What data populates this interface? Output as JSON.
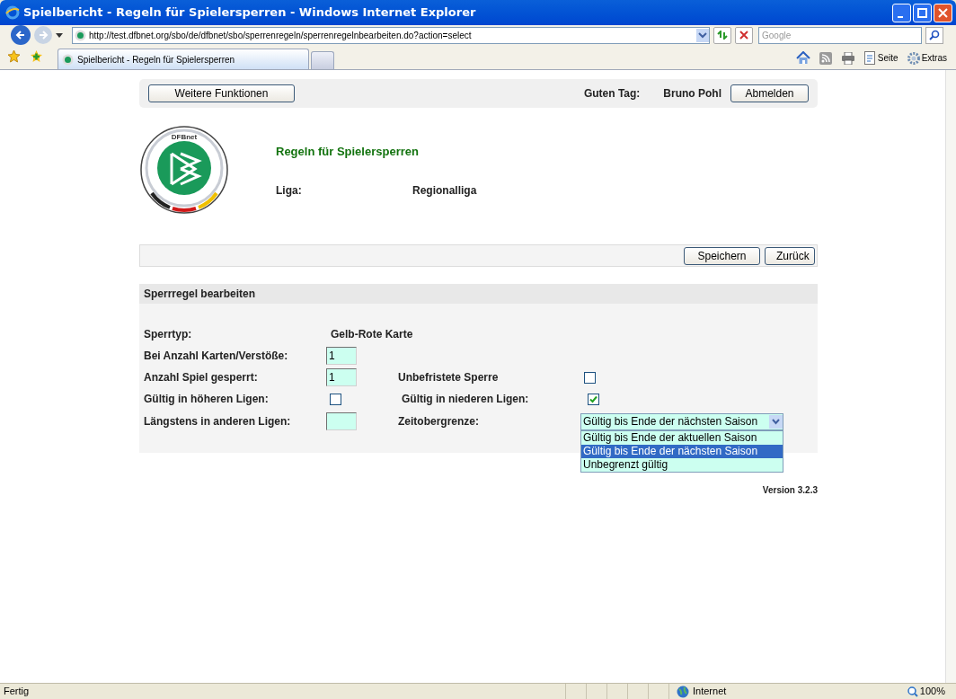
{
  "window": {
    "title": "Spielbericht - Regeln für Spielersperren - Windows Internet Explorer"
  },
  "address_bar": {
    "url": "http://test.dfbnet.org/sbo/de/dfbnet/sbo/sperrenregeln/sperrenregelnbearbeiten.do?action=select"
  },
  "search": {
    "placeholder": "Google"
  },
  "tabs": [
    {
      "label": "Spielbericht - Regeln für Spielersperren",
      "selected": true
    },
    {
      "selected": false
    }
  ],
  "command_bar": [
    "Seite",
    "Extras"
  ],
  "header": {
    "menu_button": "Weitere Funktionen",
    "greeting": "Guten Tag:",
    "user": "Bruno Pohl",
    "logout_button": "Abmelden"
  },
  "logo": {
    "text": "DFBnet"
  },
  "page_title": "Regeln für Spielersperren",
  "league": {
    "label": "Liga:",
    "value": "Regionalliga"
  },
  "action_buttons": [
    "Speichern",
    "Zurück"
  ],
  "section": {
    "title": "Sperrregel bearbeiten",
    "type": {
      "label": "Sperrtyp:",
      "value": "Gelb-Rote Karte"
    },
    "cards": {
      "label": "Bei Anzahl Karten/Verstöße:",
      "value": "1"
    },
    "games": {
      "label": "Anzahl Spiel gesperrt:",
      "value": "1"
    },
    "unlimited": {
      "label": "Unbefristete Sperre",
      "checked": false
    },
    "higher": {
      "label": "Gültig in höheren Ligen:",
      "checked": false
    },
    "lower": {
      "label": "Gültig in niederen Ligen:",
      "checked": true
    },
    "other": {
      "label": "Längstens in anderen Ligen:"
    },
    "limit": {
      "label": "Zeitobergrenze:",
      "value": "Gültig bis Ende der nächsten Saison",
      "expanded": true,
      "options": [
        {
          "label": "Gültig bis Ende der aktuellen Saison",
          "selected": false
        },
        {
          "label": "Gültig bis Ende der nächsten Saison",
          "selected": true
        },
        {
          "label": "Unbegrenzt gültig",
          "selected": false
        }
      ]
    }
  },
  "version": "Version 3.2.3",
  "status_bar": {
    "text": "Fertig",
    "zone": "Internet",
    "zoom": "100%"
  }
}
